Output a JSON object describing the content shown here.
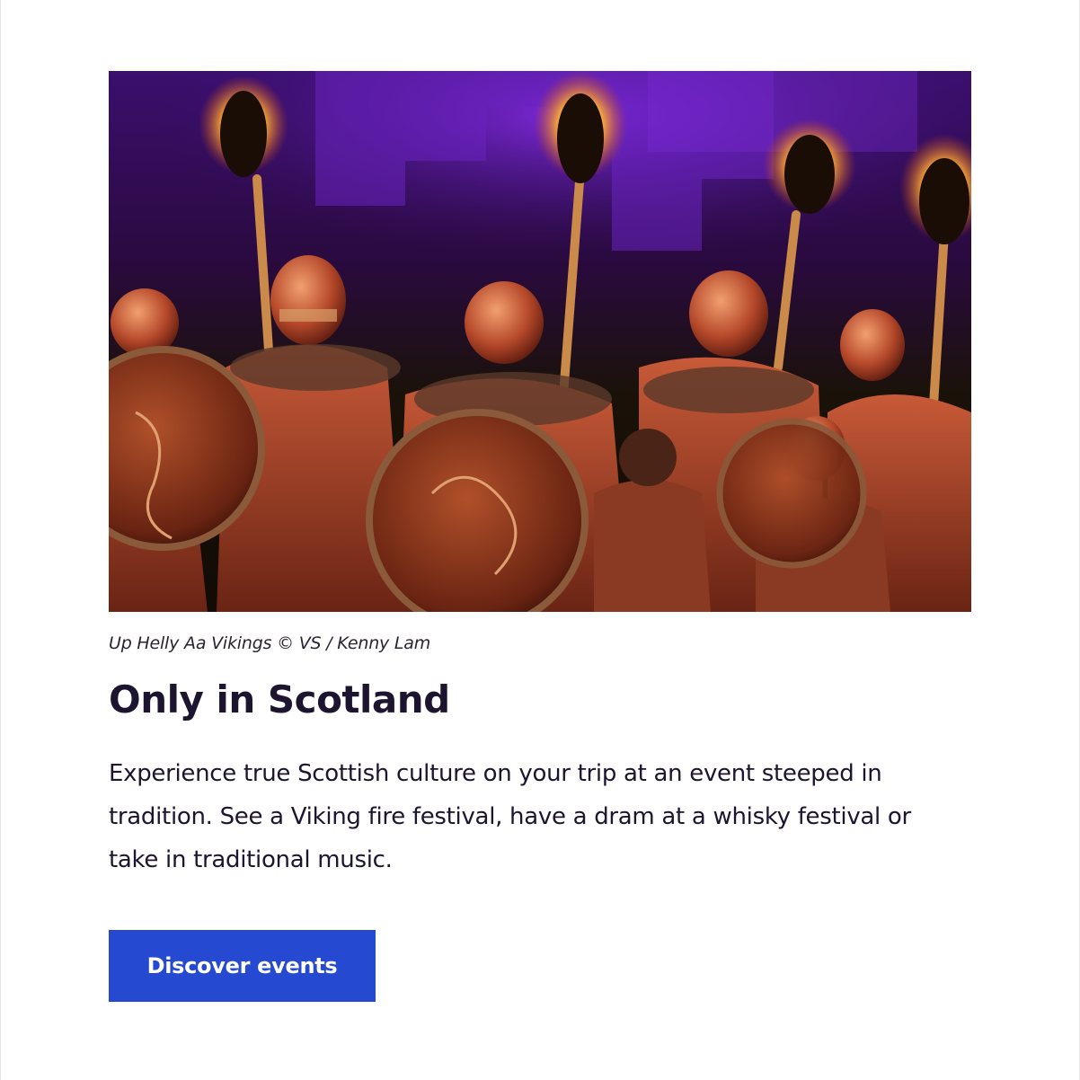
{
  "image": {
    "alt": "Up Helly Aa Vikings",
    "caption": "Up Helly Aa Vikings © VS / Kenny Lam"
  },
  "content": {
    "title": "Only in Scotland",
    "body": "Experience true Scottish culture on your trip at an event steeped in tradition. See a Viking fire festival, have a dram at a whisky festival or take in traditional music."
  },
  "cta": {
    "label": "Discover events"
  },
  "colors": {
    "title_text": "#1d1530",
    "body_text": "#1d1530",
    "button_bg": "#2649d1",
    "button_text": "#ffffff"
  }
}
